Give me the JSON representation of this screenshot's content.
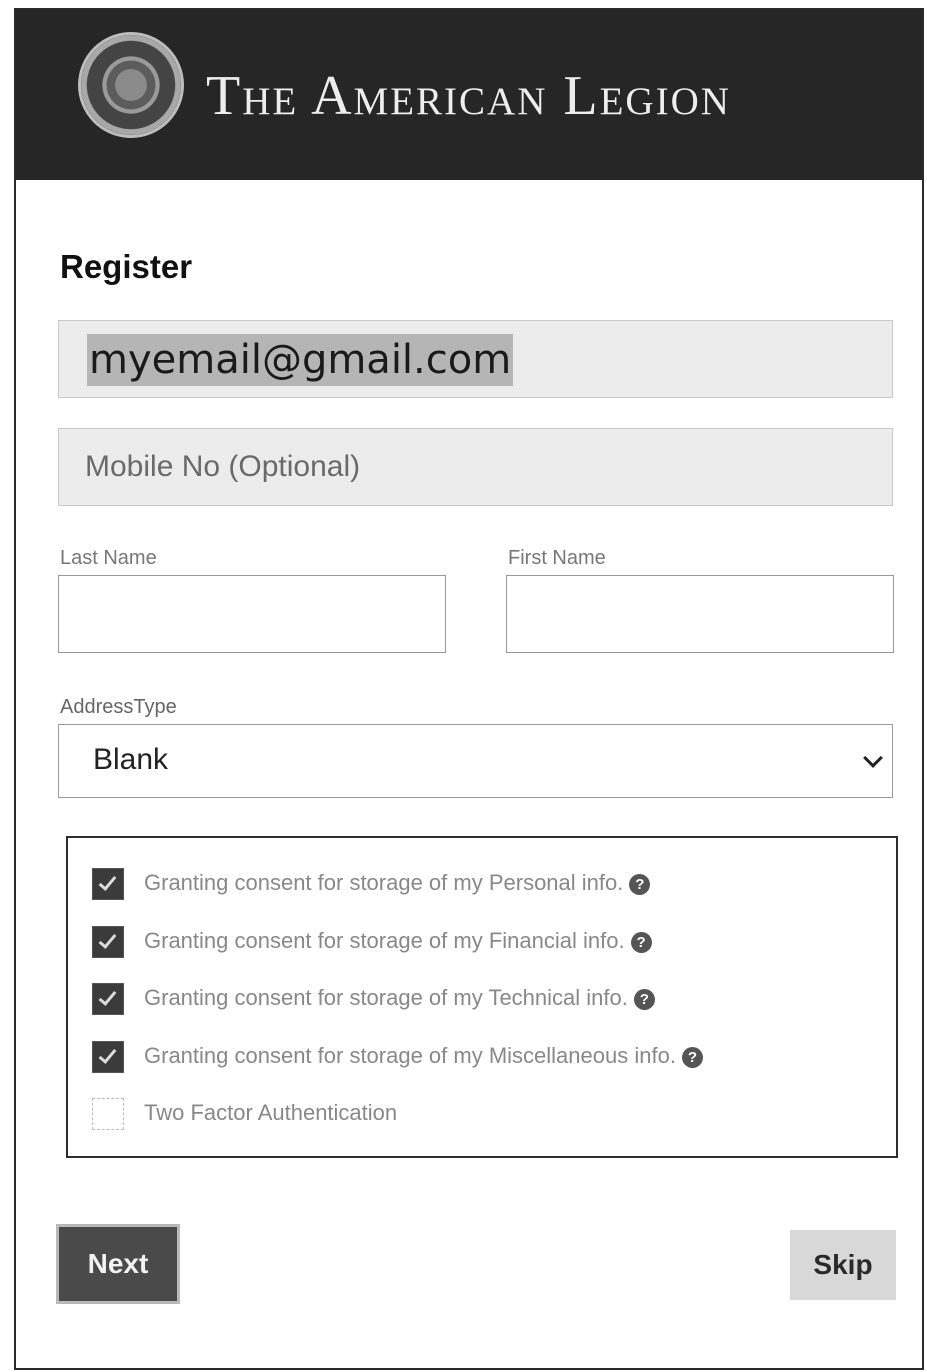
{
  "header": {
    "title": "The American Legion",
    "logo_icon": "american-legion-emblem",
    "background_color": "#262626"
  },
  "form": {
    "heading": "Register",
    "email_value": "myemail@gmail.com",
    "mobile_placeholder": "Mobile No (Optional)",
    "last_name_label": "Last Name",
    "first_name_label": "First Name",
    "address_type_label": "AddressType",
    "address_type_selected": "Blank",
    "consents": [
      {
        "label": "Granting consent for storage of my Personal info.",
        "checked": true,
        "help_icon": "question-circle-icon"
      },
      {
        "label": "Granting consent for storage of my Financial info.",
        "checked": true,
        "help_icon": "question-circle-icon"
      },
      {
        "label": "Granting consent for storage of my Technical info.",
        "checked": true,
        "help_icon": "question-circle-icon"
      },
      {
        "label": "Granting consent for storage of my Miscellaneous info.",
        "checked": true,
        "help_icon": "question-circle-icon"
      },
      {
        "label": "Two Factor Authentication",
        "checked": false
      }
    ]
  },
  "buttons": {
    "next_label": "Next",
    "skip_label": "Skip"
  },
  "colors": {
    "next_button": "#4a4a4a",
    "skip_button": "#d8d8d8"
  }
}
